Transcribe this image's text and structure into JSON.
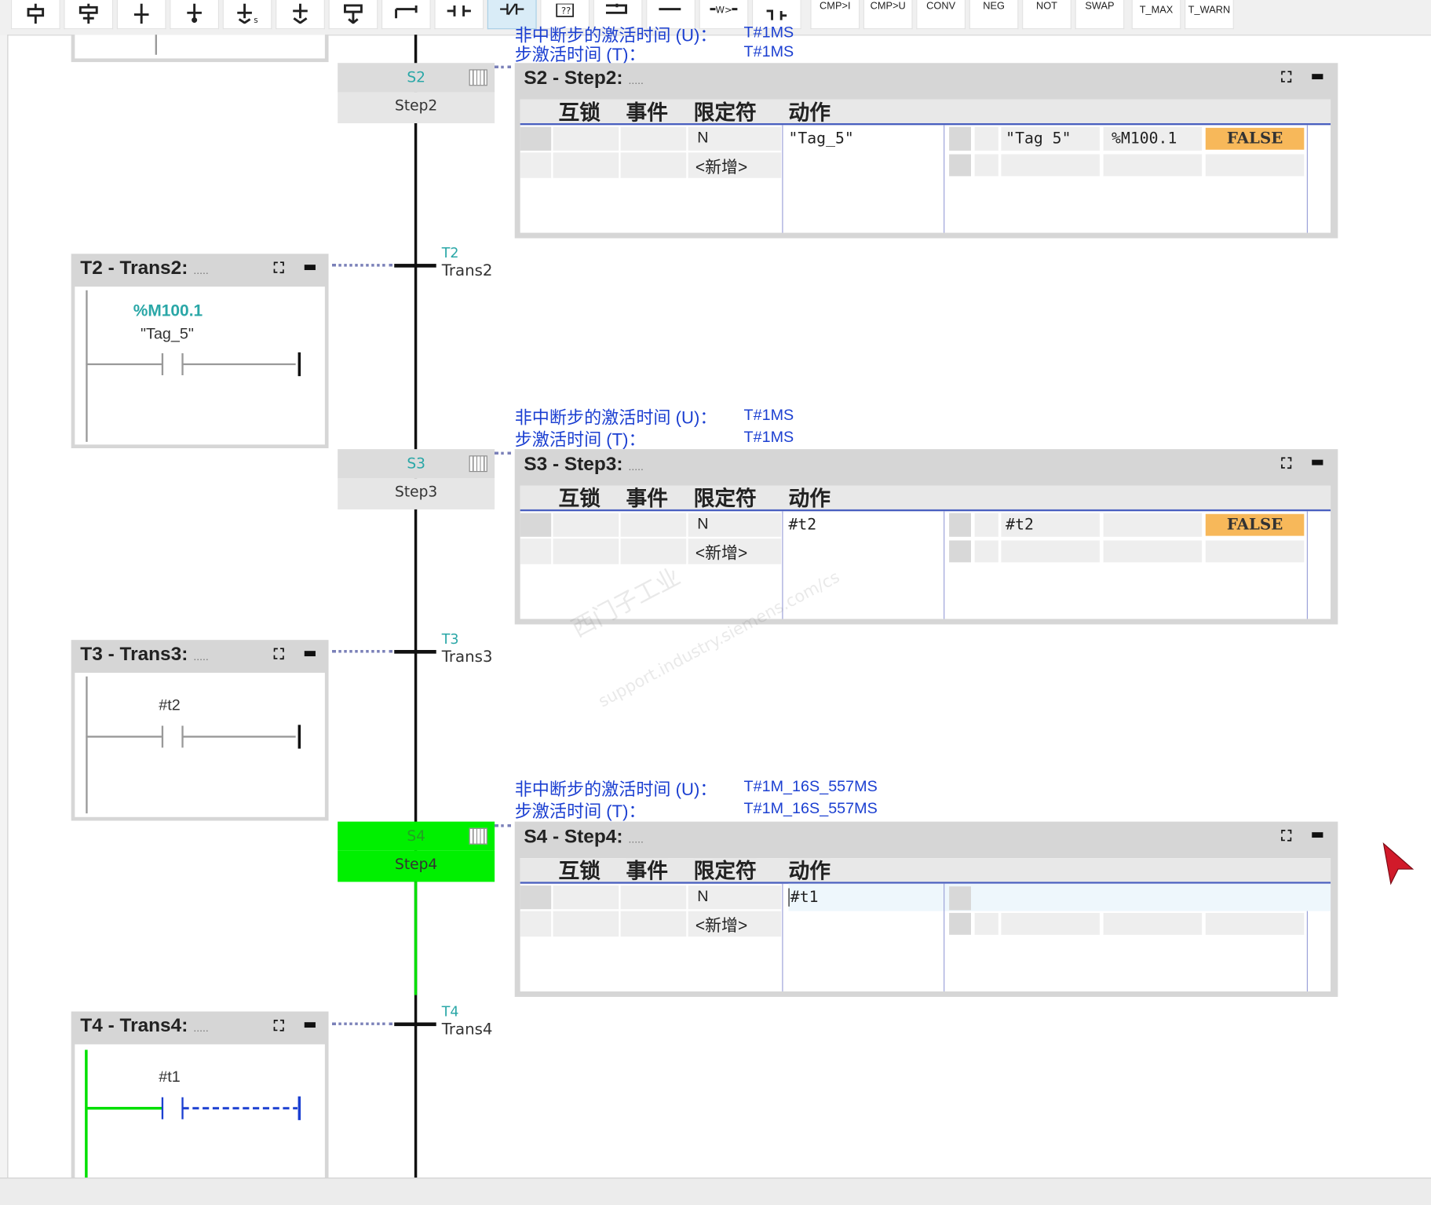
{
  "toolbar": {
    "buttons": [
      "CMP>I",
      "CMP>U",
      "CONV",
      "NEG",
      "NOT",
      "SWAP",
      "T_MAX",
      "T_WARN"
    ]
  },
  "steps": [
    {
      "id": "S2",
      "name": "Step2",
      "panel_title": "S2 - Step2:",
      "dots": ".....",
      "interlock_activation_label": "非中断步的激活时间 (U)：",
      "interlock_activation_value": "T#1MS",
      "activation_label": "步激活时间 (T)：",
      "activation_value": "T#1MS",
      "headers": [
        "互锁",
        "事件",
        "限定符",
        "动作"
      ],
      "row1": {
        "qualifier": "N",
        "action": "\"Tag_5\"",
        "operand": "\"Tag 5\"",
        "address": "%M100.1",
        "value": "FALSE"
      },
      "new_row": "<新增>"
    },
    {
      "id": "S3",
      "name": "Step3",
      "panel_title": "S3 - Step3:",
      "dots": ".....",
      "interlock_activation_label": "非中断步的激活时间 (U)：",
      "interlock_activation_value": "T#1MS",
      "activation_label": "步激活时间 (T)：",
      "activation_value": "T#1MS",
      "headers": [
        "互锁",
        "事件",
        "限定符",
        "动作"
      ],
      "row1": {
        "qualifier": "N",
        "action": "#t2",
        "operand": "#t2",
        "address": "",
        "value": "FALSE"
      },
      "new_row": "<新增>"
    },
    {
      "id": "S4",
      "name": "Step4",
      "panel_title": "S4 - Step4:",
      "dots": ".....",
      "interlock_activation_label": "非中断步的激活时间 (U)：",
      "interlock_activation_value": "T#1M_16S_557MS",
      "activation_label": "步激活时间 (T)：",
      "activation_value": "T#1M_16S_557MS",
      "headers": [
        "互锁",
        "事件",
        "限定符",
        "动作"
      ],
      "row1": {
        "qualifier": "N",
        "action": "#t1",
        "operand": "",
        "address": "",
        "value": ""
      },
      "new_row": "<新增>"
    }
  ],
  "transitions": [
    {
      "id": "T2",
      "name": "Trans2",
      "panel_title": "T2 - Trans2:",
      "dots": ".....",
      "contact_address": "%M100.1",
      "contact_tag": "\"Tag_5\""
    },
    {
      "id": "T3",
      "name": "Trans3",
      "panel_title": "T3 - Trans3:",
      "dots": ".....",
      "contact_tag": "#t2"
    },
    {
      "id": "T4",
      "name": "Trans4",
      "panel_title": "T4 - Trans4:",
      "dots": ".....",
      "contact_tag": "#t1"
    }
  ],
  "watermark": {
    "line1": "西门子工业",
    "line2": "support.industry.siemens.com/cs"
  },
  "colors": {
    "active_step": "#00f000",
    "info_text": "#1b3fd1",
    "step_id": "#2aa7a7",
    "false_badge": "#f7b85a"
  }
}
